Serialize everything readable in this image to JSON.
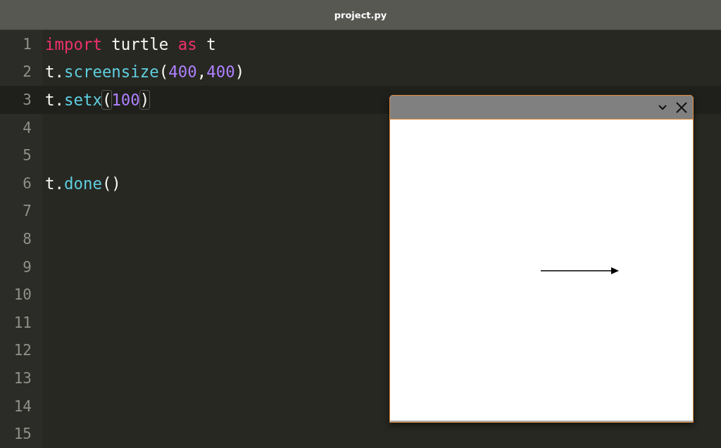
{
  "window": {
    "title": "project.py"
  },
  "editor": {
    "lines": [
      {
        "number": "1",
        "current": false,
        "tokens": [
          {
            "text": "import",
            "kind": "keyword"
          },
          {
            "text": " turtle ",
            "kind": "plain"
          },
          {
            "text": "as",
            "kind": "keyword"
          },
          {
            "text": " t",
            "kind": "plain"
          }
        ]
      },
      {
        "number": "2",
        "current": false,
        "tokens": [
          {
            "text": "t.",
            "kind": "plain"
          },
          {
            "text": "screensize",
            "kind": "function"
          },
          {
            "text": "(",
            "kind": "plain"
          },
          {
            "text": "400",
            "kind": "number"
          },
          {
            "text": ",",
            "kind": "plain"
          },
          {
            "text": "400",
            "kind": "number"
          },
          {
            "text": ")",
            "kind": "plain"
          }
        ]
      },
      {
        "number": "3",
        "current": true,
        "tokens": [
          {
            "text": "t.",
            "kind": "plain"
          },
          {
            "text": "setx",
            "kind": "function"
          },
          {
            "text": "(",
            "kind": "bracket"
          },
          {
            "text": "100",
            "kind": "number"
          },
          {
            "text": ")",
            "kind": "bracket"
          }
        ]
      },
      {
        "number": "4",
        "current": false
      },
      {
        "number": "5",
        "current": false
      },
      {
        "number": "6",
        "current": false,
        "tokens": [
          {
            "text": "t.",
            "kind": "plain"
          },
          {
            "text": "done",
            "kind": "function"
          },
          {
            "text": "()",
            "kind": "plain"
          }
        ]
      },
      {
        "number": "7",
        "current": false
      },
      {
        "number": "8",
        "current": false
      },
      {
        "number": "9",
        "current": false
      },
      {
        "number": "10",
        "current": false
      },
      {
        "number": "11",
        "current": false
      },
      {
        "number": "12",
        "current": false
      },
      {
        "number": "13",
        "current": false
      },
      {
        "number": "14",
        "current": false
      },
      {
        "number": "15",
        "current": false
      }
    ]
  }
}
